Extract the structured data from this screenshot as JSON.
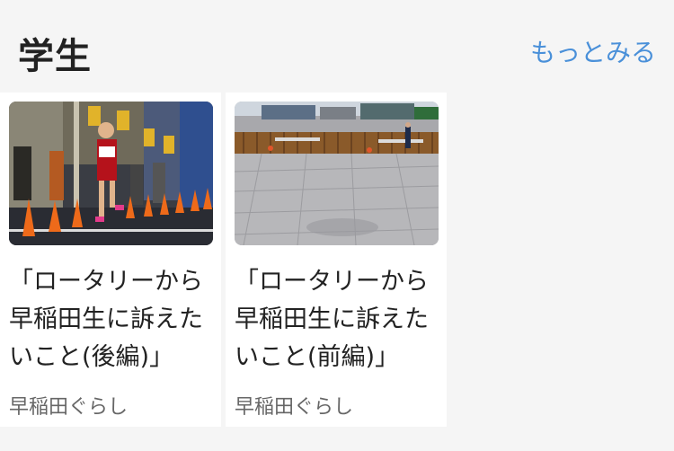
{
  "header": {
    "title": "学生",
    "more_label": "もっとみる"
  },
  "cards": [
    {
      "title": "「ロータリーから\n早稲田生に訴えた\nいこと(後編)」",
      "source": "早稲田ぐらし",
      "image_icon": "runner-photo"
    },
    {
      "title": "「ロータリーから\n早稲田生に訴えた\nいこと(前編)」",
      "source": "早稲田ぐらし",
      "image_icon": "plaza-photo"
    }
  ],
  "colors": {
    "background": "#f5f5f5",
    "card": "#ffffff",
    "accent": "#4a90d9",
    "text": "#222222",
    "subtext": "#666666"
  }
}
